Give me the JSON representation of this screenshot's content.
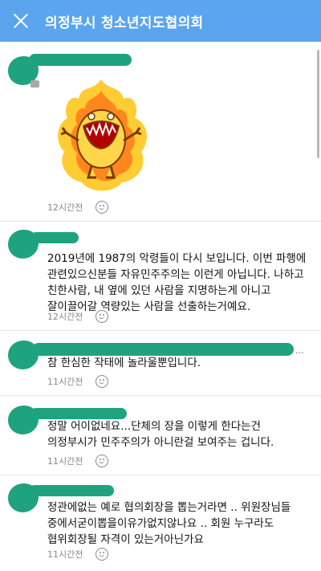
{
  "header": {
    "title": "의정부시 청소년지도협의회"
  },
  "comments": [
    {
      "author": "",
      "text": "",
      "sticker": "angry-fire-dinosaur-sticker",
      "time": "12시간전"
    },
    {
      "author": "",
      "text": "2019년에 1987의 악령들이 다시 보입니다. 이번 파행에\n관련있으신분들 자유민주주의는 이런게 아닙니다. 나하고\n친한사람, 내 옆에 있던 사람을 지명하는게 아니고\n잘이끌어갈 역량있는 사람을 선출하는거예요.",
      "time": "12시간전"
    },
    {
      "author": "",
      "text": "참  한심한 작태에 놀라울뿐입니다.",
      "time": "11시간전"
    },
    {
      "author": "",
      "text": "정말 어이없네요...단체의 장을 이렇게 한다는건\n의정부시가 민주주의가 아니란걸 보여주는 겁니다.",
      "time": "11시간전"
    },
    {
      "author": "",
      "text": "정관에없는 예로 협의회장을 뽑는거라면 .. 위원장님들\n중에서굳이뽑을이유가없지않나요 .. 회원 누구라도\n협위회장될 자격이 있는거아닌가요",
      "time": "11시간전"
    }
  ],
  "icons": {
    "close": "close-icon",
    "reaction": "smiley-icon"
  },
  "colors": {
    "header": "#5aa5ee",
    "redaction": "#1fa37f",
    "time_text": "#888888"
  }
}
